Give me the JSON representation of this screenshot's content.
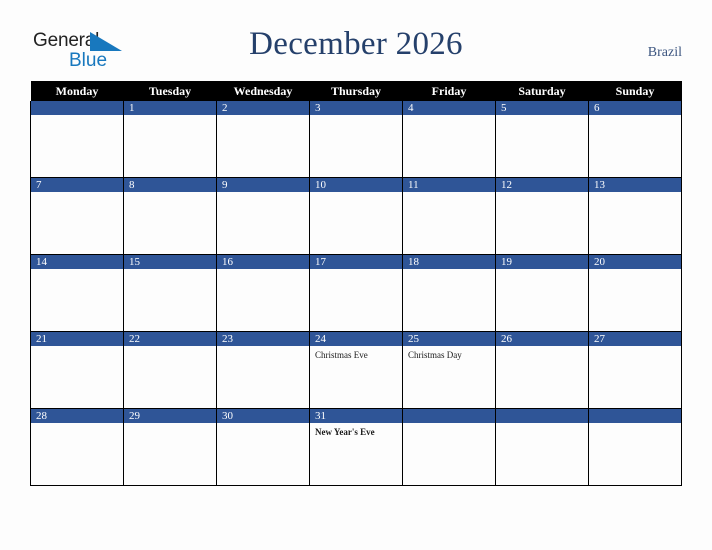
{
  "header": {
    "logo": {
      "word1": "General",
      "word2": "Blue",
      "triangle_icon": "triangle-icon",
      "blue_hex": "#1878be"
    },
    "month_title": "December 2026",
    "country": "Brazil",
    "title_color": "#25406b"
  },
  "calendar": {
    "weekday_headers": [
      "Monday",
      "Tuesday",
      "Wednesday",
      "Thursday",
      "Friday",
      "Saturday",
      "Sunday"
    ],
    "header_bg": "#000000",
    "daybar_bg": "#2f5597",
    "cell_bg": "#fdfdfd",
    "weeks": [
      [
        {
          "day": "",
          "events": []
        },
        {
          "day": "1",
          "events": []
        },
        {
          "day": "2",
          "events": []
        },
        {
          "day": "3",
          "events": []
        },
        {
          "day": "4",
          "events": []
        },
        {
          "day": "5",
          "events": []
        },
        {
          "day": "6",
          "events": []
        }
      ],
      [
        {
          "day": "7",
          "events": []
        },
        {
          "day": "8",
          "events": []
        },
        {
          "day": "9",
          "events": []
        },
        {
          "day": "10",
          "events": []
        },
        {
          "day": "11",
          "events": []
        },
        {
          "day": "12",
          "events": []
        },
        {
          "day": "13",
          "events": []
        }
      ],
      [
        {
          "day": "14",
          "events": []
        },
        {
          "day": "15",
          "events": []
        },
        {
          "day": "16",
          "events": []
        },
        {
          "day": "17",
          "events": []
        },
        {
          "day": "18",
          "events": []
        },
        {
          "day": "19",
          "events": []
        },
        {
          "day": "20",
          "events": []
        }
      ],
      [
        {
          "day": "21",
          "events": []
        },
        {
          "day": "22",
          "events": []
        },
        {
          "day": "23",
          "events": []
        },
        {
          "day": "24",
          "events": [
            "Christmas Eve"
          ]
        },
        {
          "day": "25",
          "events": [
            "Christmas Day"
          ]
        },
        {
          "day": "26",
          "events": []
        },
        {
          "day": "27",
          "events": []
        }
      ],
      [
        {
          "day": "28",
          "events": []
        },
        {
          "day": "29",
          "events": []
        },
        {
          "day": "30",
          "events": []
        },
        {
          "day": "31",
          "events": [
            "New Year's Eve"
          ]
        },
        {
          "day": "",
          "events": []
        },
        {
          "day": "",
          "events": []
        },
        {
          "day": "",
          "events": []
        }
      ]
    ]
  }
}
